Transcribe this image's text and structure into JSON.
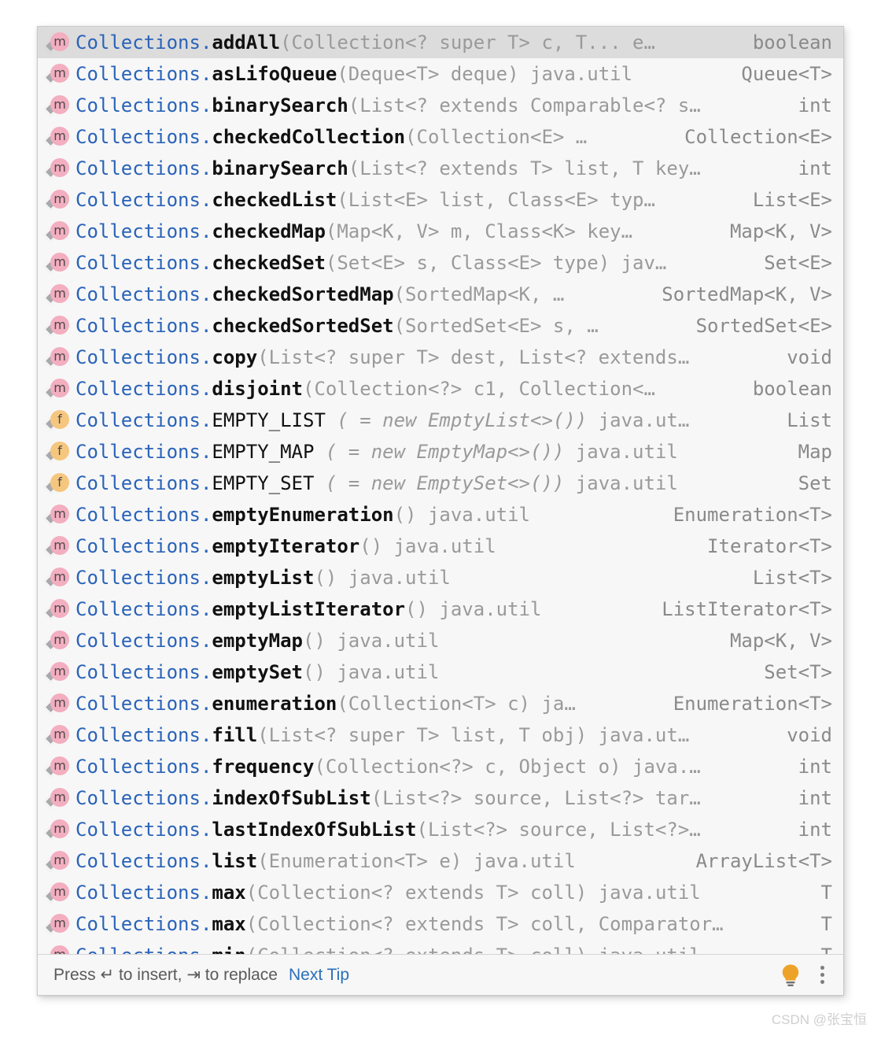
{
  "popup": {
    "selected_index": 0,
    "colors": {
      "background": "#f7f7f7",
      "selection": "#dcdcdc",
      "class_name": "#2a63b8",
      "member_name": "#111111",
      "signature_gray": "#9a9a9a",
      "method_icon": "#f3aec0",
      "field_icon": "#f5c77e",
      "link_blue": "#2a6fb8",
      "bulb_yellow": "#eda32a"
    },
    "items": [
      {
        "icon": "method-icon",
        "icon_letter": "m",
        "cls": "Collections",
        "member": "addAll",
        "signature": "(Collection<? super T> c, T... e…",
        "type": "boolean",
        "selected": true
      },
      {
        "icon": "method-icon",
        "icon_letter": "m",
        "cls": "Collections",
        "member": "asLifoQueue",
        "signature": "(Deque<T> deque) java.util",
        "type": "Queue<T>"
      },
      {
        "icon": "method-icon",
        "icon_letter": "m",
        "cls": "Collections",
        "member": "binarySearch",
        "signature": "(List<? extends Comparable<? s…",
        "type": "int"
      },
      {
        "icon": "method-icon",
        "icon_letter": "m",
        "cls": "Collections",
        "member": "checkedCollection",
        "signature": "(Collection<E> …",
        "type": "Collection<E>"
      },
      {
        "icon": "method-icon",
        "icon_letter": "m",
        "cls": "Collections",
        "member": "binarySearch",
        "signature": "(List<? extends T> list, T key…",
        "type": "int"
      },
      {
        "icon": "method-icon",
        "icon_letter": "m",
        "cls": "Collections",
        "member": "checkedList",
        "signature": "(List<E> list, Class<E> typ…",
        "type": "List<E>"
      },
      {
        "icon": "method-icon",
        "icon_letter": "m",
        "cls": "Collections",
        "member": "checkedMap",
        "signature": "(Map<K, V> m, Class<K> key…",
        "type": "Map<K, V>"
      },
      {
        "icon": "method-icon",
        "icon_letter": "m",
        "cls": "Collections",
        "member": "checkedSet",
        "signature": "(Set<E> s, Class<E> type) jav…",
        "type": "Set<E>"
      },
      {
        "icon": "method-icon",
        "icon_letter": "m",
        "cls": "Collections",
        "member": "checkedSortedMap",
        "signature": "(SortedMap<K, …",
        "type": "SortedMap<K, V>"
      },
      {
        "icon": "method-icon",
        "icon_letter": "m",
        "cls": "Collections",
        "member": "checkedSortedSet",
        "signature": "(SortedSet<E> s, …",
        "type": "SortedSet<E>"
      },
      {
        "icon": "method-icon",
        "icon_letter": "m",
        "cls": "Collections",
        "member": "copy",
        "signature": "(List<? super T> dest, List<? extends…",
        "type": "void"
      },
      {
        "icon": "method-icon",
        "icon_letter": "m",
        "cls": "Collections",
        "member": "disjoint",
        "signature": "(Collection<?> c1, Collection<…",
        "type": "boolean"
      },
      {
        "icon": "field-icon",
        "icon_letter": "f",
        "cls": "Collections",
        "member": "EMPTY_LIST",
        "member_bold": false,
        "initializer": "( = new EmptyList<>())",
        "signature": " java.ut…",
        "type": "List"
      },
      {
        "icon": "field-icon",
        "icon_letter": "f",
        "cls": "Collections",
        "member": "EMPTY_MAP",
        "member_bold": false,
        "initializer": "( = new EmptyMap<>())",
        "signature": " java.util",
        "type": "Map"
      },
      {
        "icon": "field-icon",
        "icon_letter": "f",
        "cls": "Collections",
        "member": "EMPTY_SET",
        "member_bold": false,
        "initializer": "( = new EmptySet<>())",
        "signature": " java.util",
        "type": "Set"
      },
      {
        "icon": "method-icon",
        "icon_letter": "m",
        "cls": "Collections",
        "member": "emptyEnumeration",
        "signature": "() java.util",
        "type": "Enumeration<T>"
      },
      {
        "icon": "method-icon",
        "icon_letter": "m",
        "cls": "Collections",
        "member": "emptyIterator",
        "signature": "() java.util",
        "type": "Iterator<T>"
      },
      {
        "icon": "method-icon",
        "icon_letter": "m",
        "cls": "Collections",
        "member": "emptyList",
        "signature": "() java.util",
        "type": "List<T>"
      },
      {
        "icon": "method-icon",
        "icon_letter": "m",
        "cls": "Collections",
        "member": "emptyListIterator",
        "signature": "() java.util",
        "type": "ListIterator<T>"
      },
      {
        "icon": "method-icon",
        "icon_letter": "m",
        "cls": "Collections",
        "member": "emptyMap",
        "signature": "() java.util",
        "type": "Map<K, V>"
      },
      {
        "icon": "method-icon",
        "icon_letter": "m",
        "cls": "Collections",
        "member": "emptySet",
        "signature": "() java.util",
        "type": "Set<T>"
      },
      {
        "icon": "method-icon",
        "icon_letter": "m",
        "cls": "Collections",
        "member": "enumeration",
        "signature": "(Collection<T> c) ja…",
        "type": "Enumeration<T>"
      },
      {
        "icon": "method-icon",
        "icon_letter": "m",
        "cls": "Collections",
        "member": "fill",
        "signature": "(List<? super T> list, T obj) java.ut…",
        "type": "void"
      },
      {
        "icon": "method-icon",
        "icon_letter": "m",
        "cls": "Collections",
        "member": "frequency",
        "signature": "(Collection<?> c, Object o) java.…",
        "type": "int"
      },
      {
        "icon": "method-icon",
        "icon_letter": "m",
        "cls": "Collections",
        "member": "indexOfSubList",
        "signature": "(List<?> source, List<?> tar…",
        "type": "int"
      },
      {
        "icon": "method-icon",
        "icon_letter": "m",
        "cls": "Collections",
        "member": "lastIndexOfSubList",
        "signature": "(List<?> source, List<?>…",
        "type": "int"
      },
      {
        "icon": "method-icon",
        "icon_letter": "m",
        "cls": "Collections",
        "member": "list",
        "signature": "(Enumeration<T> e) java.util",
        "type": "ArrayList<T>"
      },
      {
        "icon": "method-icon",
        "icon_letter": "m",
        "cls": "Collections",
        "member": "max",
        "signature": "(Collection<? extends T> coll) java.util",
        "type": "T"
      },
      {
        "icon": "method-icon",
        "icon_letter": "m",
        "cls": "Collections",
        "member": "max",
        "signature": "(Collection<? extends T> coll, Comparator…",
        "type": "T"
      },
      {
        "icon": "method-icon",
        "icon_letter": "m",
        "cls": "Collections",
        "member": "min",
        "signature": "(Collection<? extends T> coll) java.util",
        "type": "T"
      }
    ]
  },
  "footer": {
    "hint": "Press ↵ to insert, ⇥ to replace",
    "next_tip_label": "Next Tip",
    "bulb_icon": "lightbulb-icon",
    "more_icon": "more-options-icon"
  },
  "watermark": {
    "text": "CSDN @张宝恒"
  }
}
